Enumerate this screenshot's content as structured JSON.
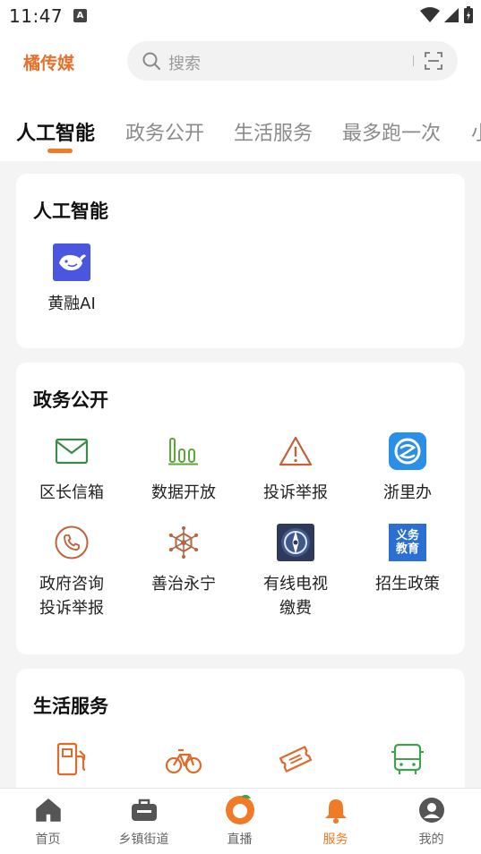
{
  "status_bar": {
    "time": "11:47",
    "notification_badge": "A"
  },
  "header": {
    "brand": "橘传媒",
    "search_placeholder": "搜索"
  },
  "tabs": [
    {
      "label": "人工智能",
      "active": true
    },
    {
      "label": "政务公开",
      "active": false
    },
    {
      "label": "生活服务",
      "active": false
    },
    {
      "label": "最多跑一次",
      "active": false
    },
    {
      "label": "小",
      "active": false
    }
  ],
  "sections": {
    "ai": {
      "title": "人工智能",
      "items": [
        {
          "label": "黄融AI",
          "icon": "whale-ai-icon"
        }
      ]
    },
    "gov": {
      "title": "政务公开",
      "items": [
        {
          "label": "区长信箱",
          "icon": "mail-icon"
        },
        {
          "label": "数据开放",
          "icon": "bar-chart-icon"
        },
        {
          "label": "投诉举报",
          "icon": "warning-icon"
        },
        {
          "label": "浙里办",
          "icon": "zheliban-icon"
        },
        {
          "label": "政府咨询",
          "label2": "投诉举报",
          "icon": "phone-icon"
        },
        {
          "label": "善治永宁",
          "icon": "shanzhi-icon"
        },
        {
          "label": "有线电视",
          "label2": "缴费",
          "icon": "cable-tv-icon"
        },
        {
          "label": "招生政策",
          "icon": "education-icon",
          "icon_text_1": "义务",
          "icon_text_2": "教育"
        }
      ]
    },
    "life": {
      "title": "生活服务",
      "items": [
        {
          "icon": "gas-station-icon"
        },
        {
          "icon": "bicycle-icon"
        },
        {
          "icon": "ticket-icon"
        },
        {
          "icon": "bus-icon"
        }
      ]
    }
  },
  "bottom_nav": [
    {
      "label": "首页",
      "icon": "home-icon",
      "active": false
    },
    {
      "label": "乡镇街道",
      "icon": "briefcase-icon",
      "active": false
    },
    {
      "label": "直播",
      "icon": "live-logo-icon",
      "active": false
    },
    {
      "label": "服务",
      "icon": "bell-icon",
      "active": true
    },
    {
      "label": "我的",
      "icon": "profile-icon",
      "active": false
    }
  ],
  "colors": {
    "accent": "#f07a26",
    "brand": "#e8702a",
    "mail_green": "#3b8a4a",
    "chart_green": "#5ba83a",
    "warning_brown": "#c0623a",
    "zheliban_blue": "#2b8fe6",
    "edu_blue": "#2a6fd1",
    "life_orange": "#e06a2a",
    "bus_green": "#3fa14d"
  }
}
